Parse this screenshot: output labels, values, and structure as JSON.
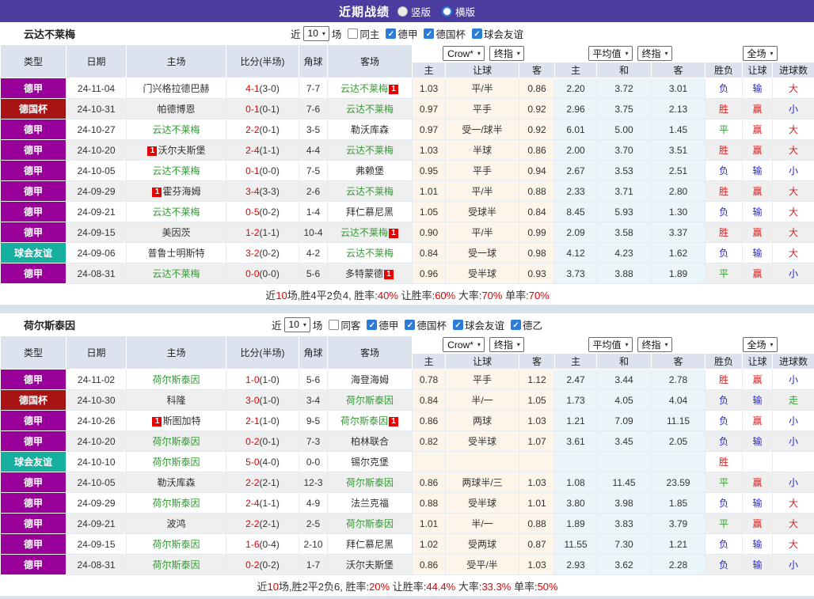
{
  "titlebar": {
    "title": "近期战绩",
    "options": [
      {
        "label": "竖版",
        "selected": false
      },
      {
        "label": "横版",
        "selected": true
      }
    ]
  },
  "colors": {
    "topbar_bg": "#4a3d9f",
    "header_bg": "#dce3ee",
    "team_green": "#339933",
    "score_red": "#e00000",
    "summary_red": "#e00000",
    "badge_bg": "#e60000",
    "odds_bg_left": "#fdf5ea",
    "odds_bg_mid": "#e9f5f9",
    "row_alt": "#efefef",
    "type_colors": {
      "德甲": "#990099",
      "德国杯": "#a81414",
      "球会友谊": "#16af9f"
    },
    "result_colors": {
      "胜": "#d42222",
      "赢": "#d42222",
      "大": "#d42222",
      "负": "#2626cc",
      "输": "#2626cc",
      "小": "#2626cc",
      "平": "#2e9e2e",
      "走": "#2e9e2e"
    }
  },
  "columns": [
    "类型",
    "日期",
    "主场",
    "比分(半场)",
    "角球",
    "客场"
  ],
  "odds_header": {
    "provider_select": "Crow*",
    "final_select": "终指",
    "avg_select": "平均值",
    "final_select2": "终指",
    "scope_select": "全场",
    "sub_cols": [
      "主",
      "让球",
      "客",
      "主",
      "和",
      "客",
      "胜负",
      "让球",
      "进球数"
    ]
  },
  "sections": [
    {
      "team": "云达不莱梅",
      "filter": {
        "prefix": "近",
        "count": "10",
        "suffix": "场",
        "checkboxes": [
          {
            "label": "同主",
            "checked": false
          },
          {
            "label": "德甲",
            "checked": true
          },
          {
            "label": "德国杯",
            "checked": true
          },
          {
            "label": "球会友谊",
            "checked": true
          }
        ]
      },
      "rows": [
        {
          "type": "德甲",
          "date": "24-11-04",
          "home": {
            "name": "门兴格拉德巴赫",
            "self": false,
            "badge": "",
            "badge_pos": ""
          },
          "score": "4-1",
          "half": "(3-0)",
          "corner": "7-7",
          "away": {
            "name": "云达不莱梅",
            "self": true,
            "badge": "1",
            "badge_pos": "post"
          },
          "odds": [
            "1.03",
            "平/半",
            "0.86",
            "2.20",
            "3.72",
            "3.01"
          ],
          "res": [
            "负",
            "输",
            "大"
          ]
        },
        {
          "type": "德国杯",
          "date": "24-10-31",
          "home": {
            "name": "帕德博恩",
            "self": false,
            "badge": "",
            "badge_pos": ""
          },
          "score": "0-1",
          "half": "(0-1)",
          "corner": "7-6",
          "away": {
            "name": "云达不莱梅",
            "self": true,
            "badge": "",
            "badge_pos": ""
          },
          "odds": [
            "0.97",
            "平手",
            "0.92",
            "2.96",
            "3.75",
            "2.13"
          ],
          "res": [
            "胜",
            "赢",
            "小"
          ]
        },
        {
          "type": "德甲",
          "date": "24-10-27",
          "home": {
            "name": "云达不莱梅",
            "self": true,
            "badge": "",
            "badge_pos": ""
          },
          "score": "2-2",
          "half": "(0-1)",
          "corner": "3-5",
          "away": {
            "name": "勒沃库森",
            "self": false,
            "badge": "",
            "badge_pos": ""
          },
          "odds": [
            "0.97",
            "受一/球半",
            "0.92",
            "6.01",
            "5.00",
            "1.45"
          ],
          "res": [
            "平",
            "赢",
            "大"
          ]
        },
        {
          "type": "德甲",
          "date": "24-10-20",
          "home": {
            "name": "沃尔夫斯堡",
            "self": false,
            "badge": "1",
            "badge_pos": "pre"
          },
          "score": "2-4",
          "half": "(1-1)",
          "corner": "4-4",
          "away": {
            "name": "云达不莱梅",
            "self": true,
            "badge": "",
            "badge_pos": ""
          },
          "odds": [
            "1.03",
            "半球",
            "0.86",
            "2.00",
            "3.70",
            "3.51"
          ],
          "res": [
            "胜",
            "赢",
            "大"
          ]
        },
        {
          "type": "德甲",
          "date": "24-10-05",
          "home": {
            "name": "云达不莱梅",
            "self": true,
            "badge": "",
            "badge_pos": ""
          },
          "score": "0-1",
          "half": "(0-0)",
          "corner": "7-5",
          "away": {
            "name": "弗赖堡",
            "self": false,
            "badge": "",
            "badge_pos": ""
          },
          "odds": [
            "0.95",
            "平手",
            "0.94",
            "2.67",
            "3.53",
            "2.51"
          ],
          "res": [
            "负",
            "输",
            "小"
          ]
        },
        {
          "type": "德甲",
          "date": "24-09-29",
          "home": {
            "name": "霍芬海姆",
            "self": false,
            "badge": "1",
            "badge_pos": "pre"
          },
          "score": "3-4",
          "half": "(3-3)",
          "corner": "2-6",
          "away": {
            "name": "云达不莱梅",
            "self": true,
            "badge": "",
            "badge_pos": ""
          },
          "odds": [
            "1.01",
            "平/半",
            "0.88",
            "2.33",
            "3.71",
            "2.80"
          ],
          "res": [
            "胜",
            "赢",
            "大"
          ]
        },
        {
          "type": "德甲",
          "date": "24-09-21",
          "home": {
            "name": "云达不莱梅",
            "self": true,
            "badge": "",
            "badge_pos": ""
          },
          "score": "0-5",
          "half": "(0-2)",
          "corner": "1-4",
          "away": {
            "name": "拜仁慕尼黑",
            "self": false,
            "badge": "",
            "badge_pos": ""
          },
          "odds": [
            "1.05",
            "受球半",
            "0.84",
            "8.45",
            "5.93",
            "1.30"
          ],
          "res": [
            "负",
            "输",
            "大"
          ]
        },
        {
          "type": "德甲",
          "date": "24-09-15",
          "home": {
            "name": "美因茨",
            "self": false,
            "badge": "",
            "badge_pos": ""
          },
          "score": "1-2",
          "half": "(1-1)",
          "corner": "10-4",
          "away": {
            "name": "云达不莱梅",
            "self": true,
            "badge": "1",
            "badge_pos": "post"
          },
          "odds": [
            "0.90",
            "平/半",
            "0.99",
            "2.09",
            "3.58",
            "3.37"
          ],
          "res": [
            "胜",
            "赢",
            "大"
          ]
        },
        {
          "type": "球会友谊",
          "date": "24-09-06",
          "home": {
            "name": "普鲁士明斯特",
            "self": false,
            "badge": "",
            "badge_pos": ""
          },
          "score": "3-2",
          "half": "(0-2)",
          "corner": "4-2",
          "away": {
            "name": "云达不莱梅",
            "self": true,
            "badge": "",
            "badge_pos": ""
          },
          "odds": [
            "0.84",
            "受一球",
            "0.98",
            "4.12",
            "4.23",
            "1.62"
          ],
          "res": [
            "负",
            "输",
            "大"
          ]
        },
        {
          "type": "德甲",
          "date": "24-08-31",
          "home": {
            "name": "云达不莱梅",
            "self": true,
            "badge": "",
            "badge_pos": ""
          },
          "score": "0-0",
          "half": "(0-0)",
          "corner": "5-6",
          "away": {
            "name": "多特蒙德",
            "self": false,
            "badge": "1",
            "badge_pos": "post"
          },
          "odds": [
            "0.96",
            "受半球",
            "0.93",
            "3.73",
            "3.88",
            "1.89"
          ],
          "res": [
            "平",
            "赢",
            "小"
          ]
        }
      ],
      "summary": [
        {
          "t": "近",
          "red": false
        },
        {
          "t": "10",
          "red": true
        },
        {
          "t": "场,胜4平2负4, 胜率:",
          "red": false
        },
        {
          "t": "40%",
          "red": true
        },
        {
          "t": " 让胜率:",
          "red": false
        },
        {
          "t": "60%",
          "red": true
        },
        {
          "t": " 大率:",
          "red": false
        },
        {
          "t": "70%",
          "red": true
        },
        {
          "t": " 单率:",
          "red": false
        },
        {
          "t": "70%",
          "red": true
        }
      ]
    },
    {
      "team": "荷尔斯泰因",
      "filter": {
        "prefix": "近",
        "count": "10",
        "suffix": "场",
        "checkboxes": [
          {
            "label": "同客",
            "checked": false
          },
          {
            "label": "德甲",
            "checked": true
          },
          {
            "label": "德国杯",
            "checked": true
          },
          {
            "label": "球会友谊",
            "checked": true
          },
          {
            "label": "德乙",
            "checked": true
          }
        ]
      },
      "rows": [
        {
          "type": "德甲",
          "date": "24-11-02",
          "home": {
            "name": "荷尔斯泰因",
            "self": true,
            "badge": "",
            "badge_pos": ""
          },
          "score": "1-0",
          "half": "(1-0)",
          "corner": "5-6",
          "away": {
            "name": "海登海姆",
            "self": false,
            "badge": "",
            "badge_pos": ""
          },
          "odds": [
            "0.78",
            "平手",
            "1.12",
            "2.47",
            "3.44",
            "2.78"
          ],
          "res": [
            "胜",
            "赢",
            "小"
          ]
        },
        {
          "type": "德国杯",
          "date": "24-10-30",
          "home": {
            "name": "科隆",
            "self": false,
            "badge": "",
            "badge_pos": ""
          },
          "score": "3-0",
          "half": "(1-0)",
          "corner": "3-4",
          "away": {
            "name": "荷尔斯泰因",
            "self": true,
            "badge": "",
            "badge_pos": ""
          },
          "odds": [
            "0.84",
            "半/一",
            "1.05",
            "1.73",
            "4.05",
            "4.04"
          ],
          "res": [
            "负",
            "输",
            "走"
          ]
        },
        {
          "type": "德甲",
          "date": "24-10-26",
          "home": {
            "name": "斯图加特",
            "self": false,
            "badge": "1",
            "badge_pos": "pre"
          },
          "score": "2-1",
          "half": "(1-0)",
          "corner": "9-5",
          "away": {
            "name": "荷尔斯泰因",
            "self": true,
            "badge": "1",
            "badge_pos": "post"
          },
          "odds": [
            "0.86",
            "两球",
            "1.03",
            "1.21",
            "7.09",
            "11.15"
          ],
          "res": [
            "负",
            "赢",
            "小"
          ]
        },
        {
          "type": "德甲",
          "date": "24-10-20",
          "home": {
            "name": "荷尔斯泰因",
            "self": true,
            "badge": "",
            "badge_pos": ""
          },
          "score": "0-2",
          "half": "(0-1)",
          "corner": "7-3",
          "away": {
            "name": "柏林联合",
            "self": false,
            "badge": "",
            "badge_pos": ""
          },
          "odds": [
            "0.82",
            "受半球",
            "1.07",
            "3.61",
            "3.45",
            "2.05"
          ],
          "res": [
            "负",
            "输",
            "小"
          ]
        },
        {
          "type": "球会友谊",
          "date": "24-10-10",
          "home": {
            "name": "荷尔斯泰因",
            "self": true,
            "badge": "",
            "badge_pos": ""
          },
          "score": "5-0",
          "half": "(4-0)",
          "corner": "0-0",
          "away": {
            "name": "锡尔克堡",
            "self": false,
            "badge": "",
            "badge_pos": ""
          },
          "odds": [
            "",
            "",
            "",
            "",
            "",
            ""
          ],
          "res": [
            "胜",
            "",
            ""
          ]
        },
        {
          "type": "德甲",
          "date": "24-10-05",
          "home": {
            "name": "勒沃库森",
            "self": false,
            "badge": "",
            "badge_pos": ""
          },
          "score": "2-2",
          "half": "(2-1)",
          "corner": "12-3",
          "away": {
            "name": "荷尔斯泰因",
            "self": true,
            "badge": "",
            "badge_pos": ""
          },
          "odds": [
            "0.86",
            "两球半/三",
            "1.03",
            "1.08",
            "11.45",
            "23.59"
          ],
          "res": [
            "平",
            "赢",
            "小"
          ]
        },
        {
          "type": "德甲",
          "date": "24-09-29",
          "home": {
            "name": "荷尔斯泰因",
            "self": true,
            "badge": "",
            "badge_pos": ""
          },
          "score": "2-4",
          "half": "(1-1)",
          "corner": "4-9",
          "away": {
            "name": "法兰克福",
            "self": false,
            "badge": "",
            "badge_pos": ""
          },
          "odds": [
            "0.88",
            "受半球",
            "1.01",
            "3.80",
            "3.98",
            "1.85"
          ],
          "res": [
            "负",
            "输",
            "大"
          ]
        },
        {
          "type": "德甲",
          "date": "24-09-21",
          "home": {
            "name": "波鸿",
            "self": false,
            "badge": "",
            "badge_pos": ""
          },
          "score": "2-2",
          "half": "(2-1)",
          "corner": "2-5",
          "away": {
            "name": "荷尔斯泰因",
            "self": true,
            "badge": "",
            "badge_pos": ""
          },
          "odds": [
            "1.01",
            "半/一",
            "0.88",
            "1.89",
            "3.83",
            "3.79"
          ],
          "res": [
            "平",
            "赢",
            "大"
          ]
        },
        {
          "type": "德甲",
          "date": "24-09-15",
          "home": {
            "name": "荷尔斯泰因",
            "self": true,
            "badge": "",
            "badge_pos": ""
          },
          "score": "1-6",
          "half": "(0-4)",
          "corner": "2-10",
          "away": {
            "name": "拜仁慕尼黑",
            "self": false,
            "badge": "",
            "badge_pos": ""
          },
          "odds": [
            "1.02",
            "受两球",
            "0.87",
            "11.55",
            "7.30",
            "1.21"
          ],
          "res": [
            "负",
            "输",
            "大"
          ]
        },
        {
          "type": "德甲",
          "date": "24-08-31",
          "home": {
            "name": "荷尔斯泰因",
            "self": true,
            "badge": "",
            "badge_pos": ""
          },
          "score": "0-2",
          "half": "(0-2)",
          "corner": "1-7",
          "away": {
            "name": "沃尔夫斯堡",
            "self": false,
            "badge": "",
            "badge_pos": ""
          },
          "odds": [
            "0.86",
            "受平/半",
            "1.03",
            "2.93",
            "3.62",
            "2.28"
          ],
          "res": [
            "负",
            "输",
            "小"
          ]
        }
      ],
      "summary": [
        {
          "t": "近",
          "red": false
        },
        {
          "t": "10",
          "red": true
        },
        {
          "t": "场,胜2平2负6, 胜率:",
          "red": false
        },
        {
          "t": "20%",
          "red": true
        },
        {
          "t": " 让胜率:",
          "red": false
        },
        {
          "t": "44.4%",
          "red": true
        },
        {
          "t": " 大率:",
          "red": false
        },
        {
          "t": "33.3%",
          "red": true
        },
        {
          "t": " 单率:",
          "red": false
        },
        {
          "t": "50%",
          "red": true
        }
      ]
    }
  ]
}
